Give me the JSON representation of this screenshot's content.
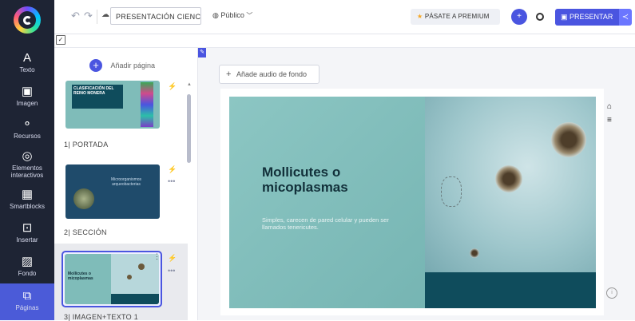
{
  "nav": [
    {
      "icon": "A",
      "label": "Texto"
    },
    {
      "icon": "🖼",
      "label": "Imagen"
    },
    {
      "icon": "°ₒ",
      "label": "Recursos"
    },
    {
      "icon": "◎",
      "label": "Elementos interactivos"
    },
    {
      "icon": "▦",
      "label": "Smartblocks"
    },
    {
      "icon": "⊕",
      "label": "Insertar"
    },
    {
      "icon": "▨",
      "label": "Fondo"
    },
    {
      "icon": "⧉",
      "label": "Páginas"
    }
  ],
  "topbar": {
    "title": "PRESENTACIÓN CIENCIA...",
    "visibility": "Público",
    "premium": "PÁSATE A PREMIUM",
    "present": "PRESENTAR"
  },
  "panel": {
    "add_page": "Añadir página",
    "pages": [
      {
        "label": "1| PORTADA",
        "thumb_title": "CLASIFICACIÓN DEL REINO MONERA"
      },
      {
        "label": "2| SECCIÓN",
        "thumb_title": "Microorganismos arqueobacterias"
      },
      {
        "label": "3| IMAGEN+TEXTO 1",
        "thumb_title": "Mollicutes o micoplasmas"
      }
    ]
  },
  "canvas": {
    "audio": "Añade audio de fondo",
    "slide_title": "Mollicutes o micoplasmas",
    "slide_subtitle": "Simples, carecen de pared celular y pueden ser llamados tenericutes."
  },
  "colors": {
    "accent": "#4a55e0",
    "nav_bg": "#1e2434",
    "slide_teal": "#7fbcb9",
    "slide_dark": "#0f4c5c",
    "premium_star": "#f5a623"
  }
}
